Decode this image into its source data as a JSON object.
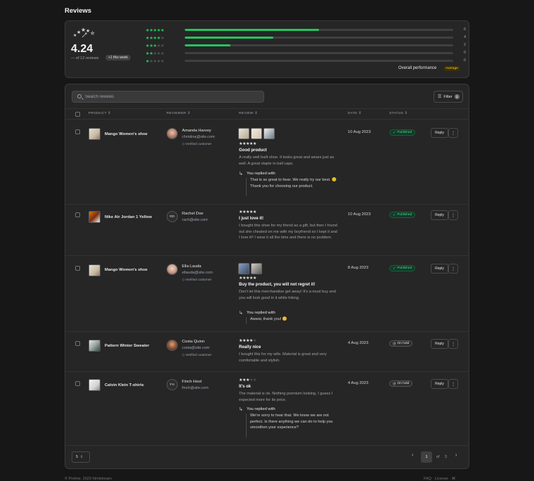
{
  "page": {
    "title": "Reviews"
  },
  "summary": {
    "average": "4.24",
    "reviews_text": "— of 12 reviews",
    "week_badge": "+1 this week",
    "distribution": [
      {
        "stars": 5,
        "count": "6",
        "fraction": 0.5
      },
      {
        "stars": 4,
        "count": "4",
        "fraction": 0.33
      },
      {
        "stars": 3,
        "count": "2",
        "fraction": 0.17
      },
      {
        "stars": 2,
        "count": "0",
        "fraction": 0
      },
      {
        "stars": 1,
        "count": "0",
        "fraction": 0
      }
    ],
    "overall_label": "Overall performance",
    "overall_badge": "Average",
    "star_color": "#22c55e"
  },
  "toolbar": {
    "search_placeholder": "Search reviews",
    "filter_label": "Filter",
    "filter_count": "1"
  },
  "columns": {
    "product": "PRODUCT",
    "reviewer": "REVIEWER",
    "review": "REVIEW",
    "date": "DATE",
    "status": "STATUS"
  },
  "rows": [
    {
      "product": "Mango Women's shoe",
      "reviewer_name": "Amanda Harvey",
      "reviewer_email": "christina@site.com",
      "verified": "Verified customer",
      "rating": 5,
      "title": "Good product",
      "body": "A really well built shoe. It looks great and wears just as well. A great staple in ball caps.",
      "reply_label": "You replied with",
      "reply": "That is so great to hear. We really try our best. 😊 Thank you for choosing our product.",
      "date": "10 Aug 2023",
      "status": "Published",
      "action": "Reply"
    },
    {
      "product": "Nike Air Jordan 1 Yellow",
      "reviewer_initials": "RD",
      "reviewer_name": "Rachel Doe",
      "reviewer_email": "rach@site.com",
      "rating": 5,
      "title": "I just love it!",
      "body": "I bought this shoe for my friend as a gift, but then I found out she cheated on me with my boyfriend so I kept it and I love it!! I wear it all the time and there is no problem.",
      "date": "10 Aug 2023",
      "status": "Published",
      "action": "Reply"
    },
    {
      "product": "Mango Women's shoe",
      "reviewer_name": "Ella Lauda",
      "reviewer_email": "ellauda@site.com",
      "verified": "Verified customer",
      "rating": 5,
      "title": "Buy the product, you will not regret it!",
      "body": "Don't let this merchandise get away! It's a must buy and you will look good in it while hiking.",
      "reply_label": "You replied with",
      "reply": "Awww, thank you! 😊",
      "date": "8 Aug 2023",
      "status": "Published",
      "action": "Reply"
    },
    {
      "product": "Pattern Winter Sweater",
      "reviewer_name": "Costa Quinn",
      "reviewer_email": "costa@site.com",
      "verified": "Verified customer",
      "rating": 4,
      "title": "Really nice",
      "body": "I bought this for my wife. Material is great and very comfortable and stylish.",
      "date": "4 Aug 2023",
      "status": "On hold",
      "action": "Reply"
    },
    {
      "product": "Calvin Klein T-shirts",
      "reviewer_initials": "FH",
      "reviewer_name": "Finch Hoot",
      "reviewer_email": "finch@site.com",
      "rating": 3,
      "title": "It's ok",
      "body": "The material is ok. Nothing premium looking. I guess I expected more for its price.",
      "reply_label": "You replied with",
      "reply": "We're sorry to hear that. We know we are not perfect. Is there anything we can do to help you smoothen your experience?",
      "date": "4 Aug 2023",
      "status": "On hold",
      "action": "Reply"
    }
  ],
  "pagination": {
    "per_page": "5",
    "current": "1",
    "of": "of",
    "total": "3"
  },
  "footer": {
    "left": "© Preline. 2023 htmlstream.",
    "right": "FAQ  ·  License  ·  ⌘"
  },
  "icons": {
    "search": "search-icon",
    "filter": "filter-icon",
    "check": "check-icon",
    "clock": "clock-icon",
    "more": "more-vertical-icon",
    "reply": "reply-arrow-icon",
    "shield": "shield-check-icon"
  }
}
